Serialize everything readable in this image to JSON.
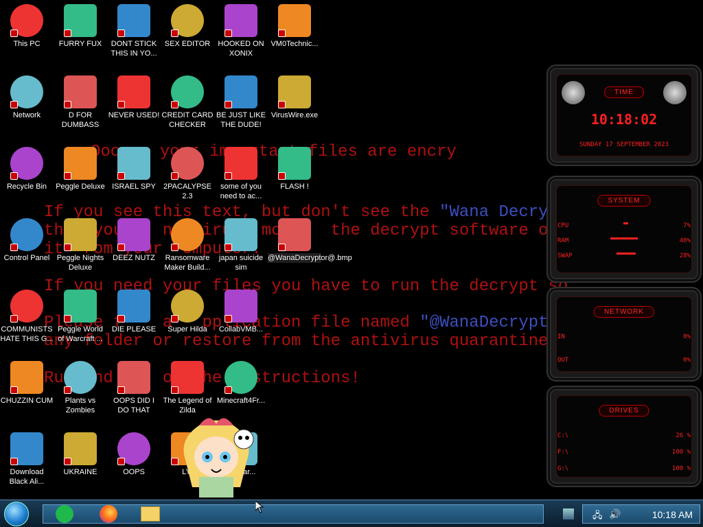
{
  "wallpaper": {
    "line1": "Ooops, your important files are encry",
    "line2a": "If you see this text, but don't see the ",
    "line2b": "\"Wana Decryp",
    "line3": "that you    ntivirus  mo     the decrypt software or",
    "line4": "it  rom your  omputer.",
    "line5": "If you need your files you have to run the decrypt so",
    "line6a": "Please f    a   pplication file named ",
    "line6b": "\"@WanaDecrypto",
    "line7": "any folder or restore from the antivirus quarantine.",
    "line8": "Run  nd  o  ow  he  nstructions!"
  },
  "icons": [
    {
      "label": "This PC",
      "col": 0,
      "row": 0
    },
    {
      "label": "FURRY FUX",
      "col": 1,
      "row": 0
    },
    {
      "label": "DONT STICK THIS IN YO...",
      "col": 2,
      "row": 0
    },
    {
      "label": "SEX EDITOR",
      "col": 3,
      "row": 0
    },
    {
      "label": "HOOKED ON XONIX",
      "col": 4,
      "row": 0
    },
    {
      "label": "VM0Technic...",
      "col": 5,
      "row": 0
    },
    {
      "label": "Network",
      "col": 0,
      "row": 1
    },
    {
      "label": "D FOR DUMBASS",
      "col": 1,
      "row": 1
    },
    {
      "label": "NEVER USED!",
      "col": 2,
      "row": 1
    },
    {
      "label": "CREDIT CARD CHECKER",
      "col": 3,
      "row": 1
    },
    {
      "label": "BE JUST LIKE THE DUDE!",
      "col": 4,
      "row": 1
    },
    {
      "label": "VirusWire.exe",
      "col": 5,
      "row": 1
    },
    {
      "label": "Recycle Bin",
      "col": 0,
      "row": 2
    },
    {
      "label": "Peggle Deluxe",
      "col": 1,
      "row": 2
    },
    {
      "label": "ISRAEL SPY",
      "col": 2,
      "row": 2
    },
    {
      "label": "2PACALYPSE 2.3",
      "col": 3,
      "row": 2
    },
    {
      "label": "some of you need to ac...",
      "col": 4,
      "row": 2
    },
    {
      "label": "FLASH !",
      "col": 5,
      "row": 2
    },
    {
      "label": "Control Panel",
      "col": 0,
      "row": 3
    },
    {
      "label": "Peggle Nights Deluxe",
      "col": 1,
      "row": 3
    },
    {
      "label": "DEEZ NUTZ",
      "col": 2,
      "row": 3
    },
    {
      "label": "Ransomware Maker Build...",
      "col": 3,
      "row": 3
    },
    {
      "label": "japan suicide sim",
      "col": 4,
      "row": 3
    },
    {
      "label": "@WanaDecryptor@.bmp",
      "col": 5,
      "row": 3
    },
    {
      "label": "COMMUNISTS HATE THIS G...",
      "col": 0,
      "row": 4
    },
    {
      "label": "Peggle World of Warcraft ...",
      "col": 1,
      "row": 4
    },
    {
      "label": "DIE PLEASE",
      "col": 2,
      "row": 4
    },
    {
      "label": "Super Hilda",
      "col": 3,
      "row": 4
    },
    {
      "label": "CollabVMB...",
      "col": 4,
      "row": 4
    },
    {
      "label": "CHUZZIN CUM",
      "col": 0,
      "row": 5
    },
    {
      "label": "Plants vs Zombies",
      "col": 1,
      "row": 5
    },
    {
      "label": "OOPS DID I DO THAT",
      "col": 2,
      "row": 5
    },
    {
      "label": "The Legend of Zilda",
      "col": 3,
      "row": 5
    },
    {
      "label": "Minecraft4Fr...",
      "col": 4,
      "row": 5
    },
    {
      "label": "Download Black Ali...",
      "col": 0,
      "row": 6
    },
    {
      "label": "UKRAINE",
      "col": 1,
      "row": 6
    },
    {
      "label": "OOPS",
      "col": 2,
      "row": 6
    },
    {
      "label": "LYI",
      "col": 3,
      "row": 6
    },
    {
      "label": "smWar...",
      "col": 4,
      "row": 6
    }
  ],
  "gadgets": {
    "time": {
      "title": "TIME",
      "clock": "10:18:02",
      "date": "SUNDAY 17 SEPTEMBER 2023"
    },
    "system": {
      "title": "SYSTEM",
      "cpu_label": "CPU",
      "cpu_val": "7%",
      "ram_label": "RAM",
      "ram_val": "40%",
      "swap_label": "SWAP",
      "swap_val": "28%",
      "cpu_pct": 0.07,
      "ram_pct": 0.4,
      "swap_pct": 0.28
    },
    "network": {
      "title": "NETWORK",
      "in_label": "IN",
      "in_val": "0%",
      "out_label": "OUT",
      "out_val": "0%"
    },
    "drives": {
      "title": "DRIVES",
      "d1_label": "C:\\",
      "d1_val": "26 %",
      "d2_label": "F:\\",
      "d2_val": "100 %",
      "d3_label": "G:\\",
      "d3_val": "100 %"
    }
  },
  "taskbar": {
    "clock": "10:18 AM",
    "pinned": [
      "green-app-icon",
      "firefox-icon",
      "file-explorer-icon"
    ]
  },
  "colors": {
    "ransom_red": "#b01010",
    "ransom_blue": "#3c4fc0",
    "gadget_red": "#ff2020"
  }
}
